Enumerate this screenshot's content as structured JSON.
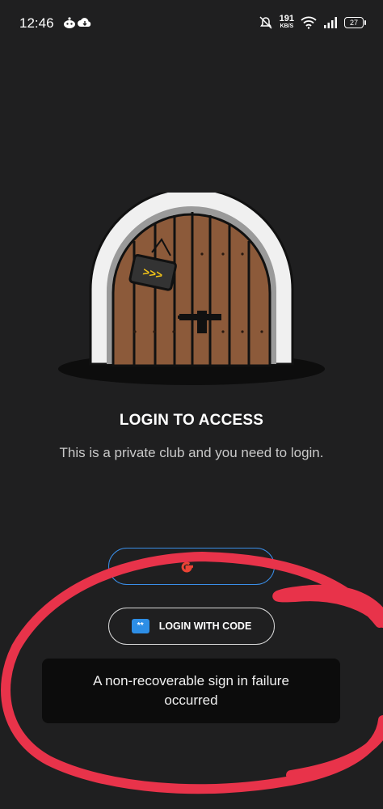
{
  "status_bar": {
    "time": "12:46",
    "left_icons": [
      "reddit-icon",
      "cloud-download-icon"
    ],
    "net_speed_value": "191",
    "net_speed_unit": "KB/S",
    "right_icons": [
      "mute-icon",
      "wifi-icon",
      "signal-icon"
    ],
    "battery": "27"
  },
  "hero": {
    "illustration": "wooden-door-icon",
    "title": "LOGIN TO ACCESS",
    "subtitle": "This is a private club and you need to login."
  },
  "buttons": {
    "google_label": "",
    "code_icon_text": "**",
    "code_label": "LOGIN WITH CODE"
  },
  "toast": {
    "message": "A non-recoverable sign in failure occurred"
  },
  "annotation": {
    "scribble_color": "#e8334a"
  }
}
